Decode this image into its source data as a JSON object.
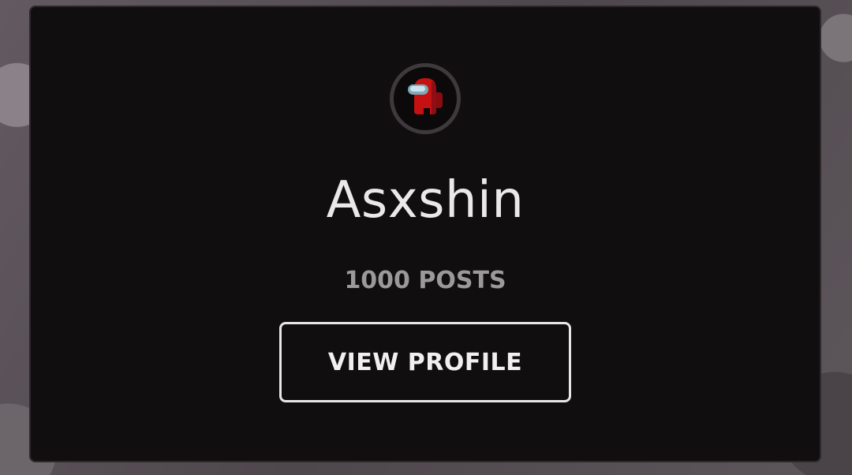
{
  "profile_card": {
    "avatar_icon": "crewmate-avatar-icon",
    "username": "Asxshin",
    "posts_label": "1000 POSTS",
    "view_profile_label": "VIEW PROFILE"
  },
  "colors": {
    "card_background": "#110e10",
    "username_text": "#ebe8ea",
    "posts_text": "#9c999b",
    "button_border": "#e8e6e7",
    "avatar_ring": "#3d393c",
    "crewmate_red": "#c51111"
  }
}
